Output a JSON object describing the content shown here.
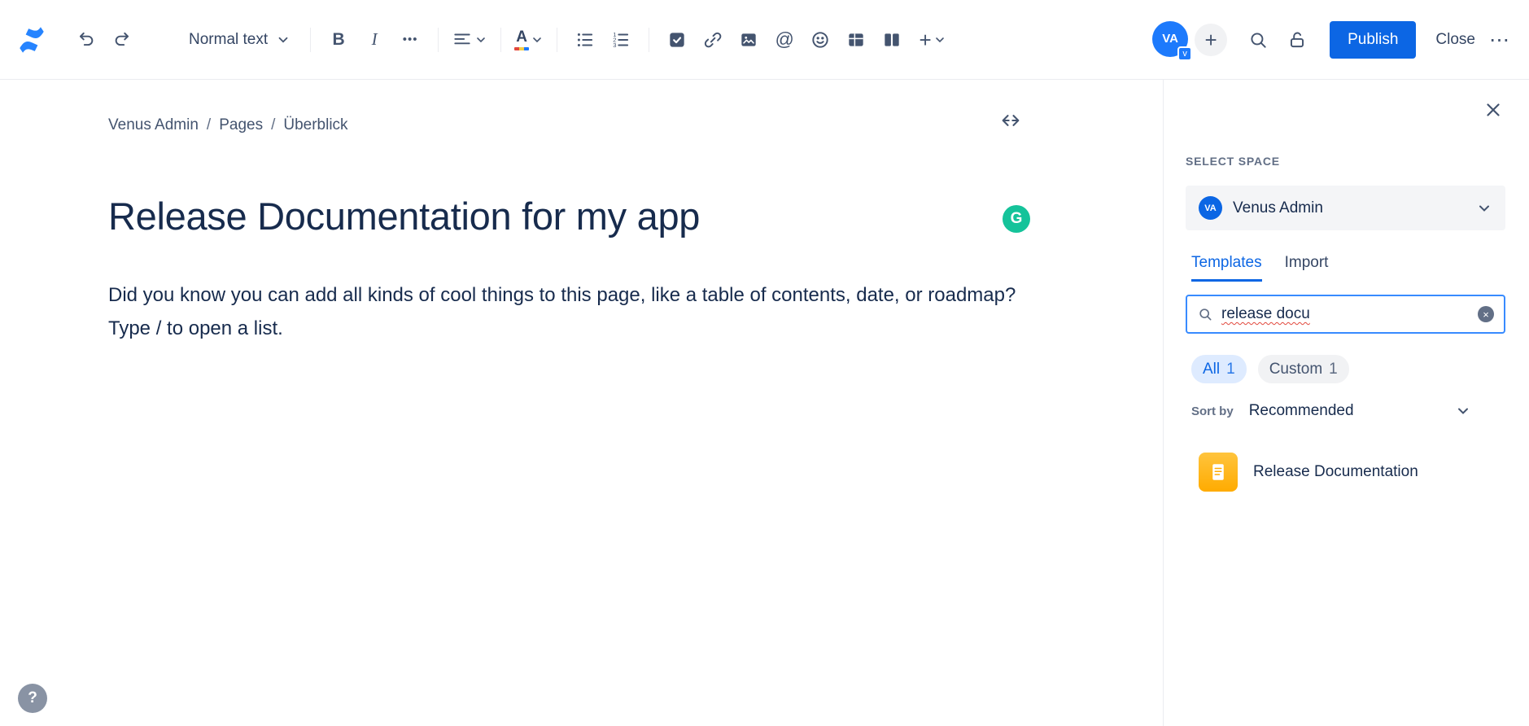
{
  "toolbar": {
    "text_style": "Normal text",
    "bold": "B",
    "italic": "I",
    "more_formatting": "•••",
    "color_letter": "A",
    "mention": "@",
    "avatar_initials": "VA",
    "avatar_badge": "v",
    "invite_plus": "+",
    "insert_plus": "+",
    "publish": "Publish",
    "close": "Close",
    "more_menu": "⋯"
  },
  "breadcrumb": {
    "item1": "Venus Admin",
    "item2": "Pages",
    "item3": "Überblick",
    "separator": "/"
  },
  "content": {
    "title": "Release Documentation for my app",
    "body_line1": "Did you know you can add all kinds of cool things to this page, like a table of contents, date, or roadmap?",
    "body_line2": "Type / to open a list.",
    "grammarly_letter": "G",
    "help_glyph": "?"
  },
  "panel": {
    "select_space_label": "SELECT SPACE",
    "space_initials": "VA",
    "space_name": "Venus Admin",
    "tab_templates": "Templates",
    "tab_import": "Import",
    "search_value": "release docu",
    "clear_glyph": "×",
    "filter_all": "All",
    "filter_all_count": "1",
    "filter_custom": "Custom",
    "filter_custom_count": "1",
    "sort_label": "Sort by",
    "sort_value": "Recommended",
    "template_name": "Release Documentation"
  },
  "colors": {
    "accent_blue": "#0C66E4",
    "toolbar_icon_gray": "#44546F",
    "text_dark": "#172B4D",
    "grammarly_green": "#15C39A",
    "template_icon_orange": "#FFAB00",
    "search_focus_border": "#388BFF",
    "spellcheck_red": "#E2483D"
  }
}
